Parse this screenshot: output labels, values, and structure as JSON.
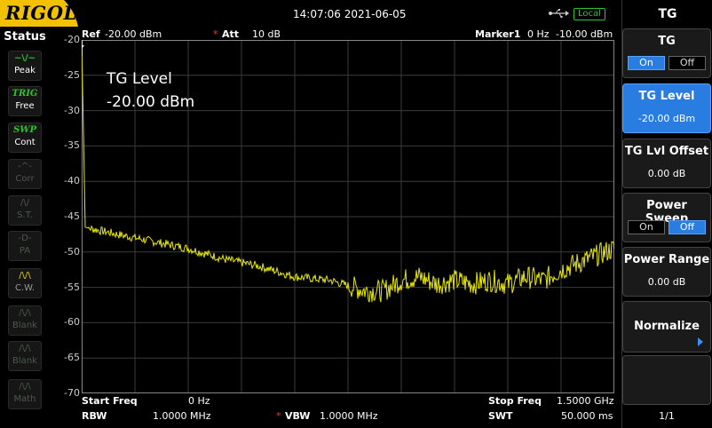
{
  "topbar": {
    "logo": "RIGOL",
    "datetime": "14:07:06 2021-06-05",
    "usb_icon": "usb-icon",
    "local_badge": "Local"
  },
  "status": {
    "title": "Status",
    "items": [
      {
        "glyph": "~\\/~",
        "label": "Peak",
        "state": "active-icon"
      },
      {
        "glyph": "TRIG",
        "label": "Free",
        "state": "active"
      },
      {
        "glyph": "SWP",
        "label": "Cont",
        "state": "active"
      },
      {
        "glyph": "-^-",
        "label": "Corr",
        "state": "dim"
      },
      {
        "glyph": "/\\/",
        "label": "S.T.",
        "state": "dim"
      },
      {
        "glyph": "-D-",
        "label": "PA",
        "state": "dim"
      },
      {
        "glyph": "/\\/\\",
        "label": "C.W.",
        "state": "cw"
      },
      {
        "glyph": "/\\/\\",
        "label": "Blank",
        "state": "dim"
      },
      {
        "glyph": "/\\/\\",
        "label": "Blank",
        "state": "dim"
      },
      {
        "glyph": "/\\/\\",
        "label": "Math",
        "state": "dim"
      }
    ]
  },
  "header": {
    "ref_label": "Ref",
    "ref_value": "-20.00 dBm",
    "att_marker": "*",
    "att_label": "Att",
    "att_value": "10 dB",
    "marker_label": "Marker1",
    "marker_freq": "0 Hz",
    "marker_level": "-10.00 dBm"
  },
  "overlay": {
    "title": "TG Level",
    "value": "-20.00 dBm"
  },
  "footer": {
    "start_label": "Start Freq",
    "start_value": "0 Hz",
    "stop_label": "Stop Freq",
    "stop_value": "1.5000 GHz",
    "rbw_label": "RBW",
    "rbw_value": "1.0000 MHz",
    "vbw_marker": "*",
    "vbw_label": "VBW",
    "vbw_value": "1.0000 MHz",
    "swt_label": "SWT",
    "swt_value": "50.000 ms"
  },
  "chart_data": {
    "type": "line",
    "x_unit": "GHz",
    "xlim": [
      0,
      1.5
    ],
    "ylim": [
      -70,
      -20
    ],
    "y_ticks": [
      "-20",
      "-25",
      "-30",
      "-35",
      "-40",
      "-45",
      "-50",
      "-55",
      "-60",
      "-65",
      "-70"
    ],
    "trace_color": "#e8e800",
    "grid": true,
    "series": [
      {
        "x": [
          0,
          0.005,
          0.01,
          0.1,
          0.2,
          0.3,
          0.4,
          0.5,
          0.6,
          0.7,
          0.8,
          0.85,
          0.9,
          0.95,
          1.0,
          1.05,
          1.1,
          1.15,
          1.2,
          1.25,
          1.3,
          1.35,
          1.4,
          1.45,
          1.5
        ],
        "y": [
          -20,
          -33,
          -46.5,
          -47.5,
          -48.5,
          -49.5,
          -51,
          -52,
          -53.5,
          -54,
          -55.5,
          -55.5,
          -54,
          -53.5,
          -54.5,
          -54,
          -54.5,
          -54,
          -54.5,
          -53.5,
          -54,
          -52.5,
          -51.5,
          -50.5,
          -49.5
        ]
      }
    ]
  },
  "menu": {
    "title": "TG",
    "keys": [
      {
        "label": "TG",
        "on": "On",
        "off": "Off",
        "state": "on"
      },
      {
        "label": "TG Level",
        "value": "-20.00 dBm",
        "selected": true
      },
      {
        "label": "TG Lvl Offset",
        "value": "0.00 dB"
      },
      {
        "label": "Power Sweep",
        "on": "On",
        "off": "Off",
        "state": "off"
      },
      {
        "label": "Power Range",
        "value": "0.00 dB"
      },
      {
        "label": "Normalize"
      }
    ],
    "page": "1/1"
  }
}
